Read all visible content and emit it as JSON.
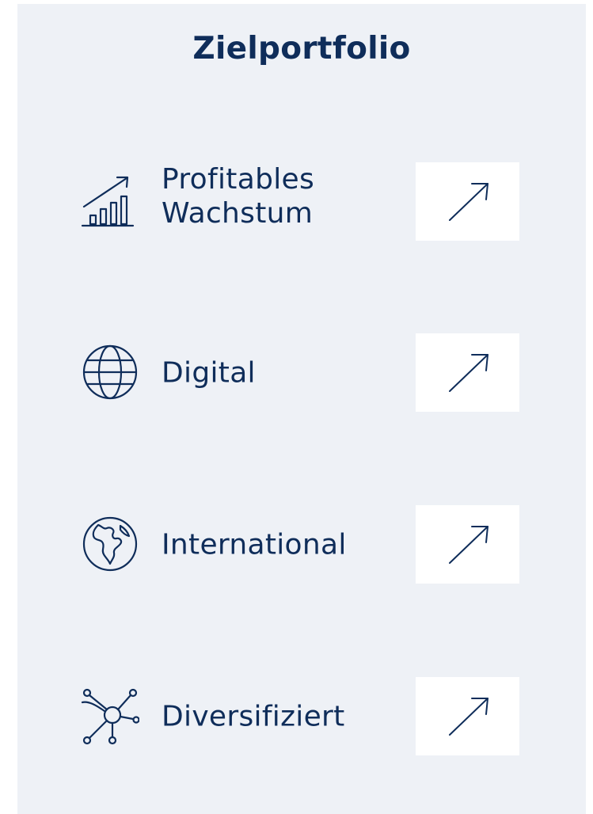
{
  "title": "Zielportfolio",
  "colors": {
    "panel_background": "#eef1f6",
    "text_primary": "#0f2d5a",
    "trend_box_background": "#ffffff"
  },
  "rows": [
    {
      "icon": "growth-chart-icon",
      "label_line1": "Profitables",
      "label_line2": "Wachstum",
      "trend": "arrow-up-right-icon"
    },
    {
      "icon": "globe-grid-icon",
      "label": "Digital",
      "trend": "arrow-up-right-icon"
    },
    {
      "icon": "earth-continents-icon",
      "label": "International",
      "trend": "arrow-up-right-icon"
    },
    {
      "icon": "network-nodes-icon",
      "label": "Diversifiziert",
      "trend": "arrow-up-right-icon"
    }
  ]
}
